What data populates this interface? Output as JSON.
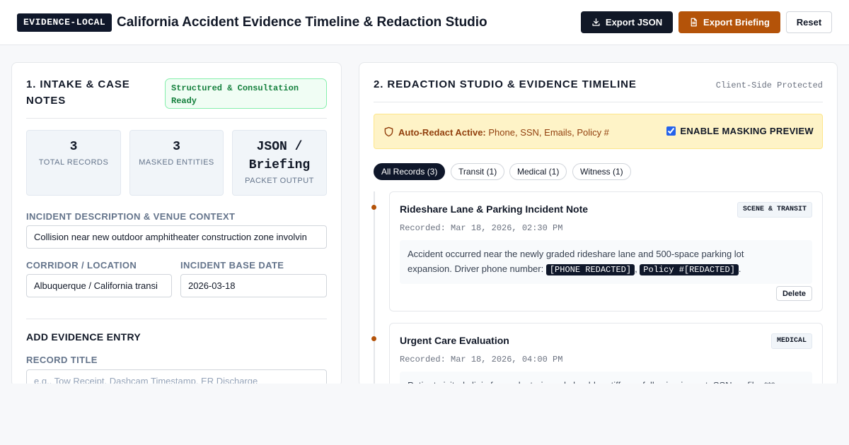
{
  "header": {
    "brand": "EVIDENCE-LOCAL",
    "title": "California Accident Evidence Timeline & Redaction Studio",
    "export_json_label": "Export JSON",
    "export_briefing_label": "Export Briefing",
    "reset_label": "Reset"
  },
  "intake": {
    "title_line1": "1. INTAKE & CASE",
    "title_line2": "NOTES",
    "status_line1": "Structured & Consultation",
    "status_line2": "Ready",
    "stats": [
      {
        "value": "3",
        "label": "TOTAL RECORDS"
      },
      {
        "value": "3",
        "label": "MASKED ENTITIES"
      },
      {
        "value_line1": "JSON /",
        "value_line2": "Briefing",
        "label": "PACKET OUTPUT"
      }
    ],
    "description_label": "INCIDENT DESCRIPTION & VENUE CONTEXT",
    "description_value": "Collision near new outdoor amphitheater construction zone involvin",
    "corridor_label": "CORRIDOR / LOCATION",
    "corridor_value": "Albuquerque / California transi",
    "date_label": "INCIDENT BASE DATE",
    "date_value": "2026-03-18",
    "add_title": "ADD EVIDENCE ENTRY",
    "record_title_label": "RECORD TITLE",
    "record_title_placeholder": "e.g., Tow Receipt, Dashcam Timestamp, ER Discharge"
  },
  "studio": {
    "title": "2. REDACTION STUDIO & EVIDENCE TIMELINE",
    "protected": "Client-Side Protected",
    "banner_bold": "Auto-Redact Active:",
    "banner_text": "Phone, SSN, Emails, Policy #",
    "mask_label": "ENABLE MASKING PREVIEW",
    "filters": [
      "All Records (3)",
      "Transit (1)",
      "Medical (1)",
      "Witness (1)"
    ],
    "entries": [
      {
        "title": "Rideshare Lane & Parking Incident Note",
        "tag": "SCENE & TRANSIT",
        "recorded": "Recorded: Mar 18, 2026, 02:30 PM",
        "body_line1": "Accident occurred near the newly graded rideshare lane and 500-space parking lot",
        "body_line2_pre": "expansion. Driver phone number: ",
        "chip1": "[PHONE REDACTED]",
        "sep": ", ",
        "chip2": "Policy #[REDACTED]",
        "end": ".",
        "delete_label": "Delete"
      },
      {
        "title": "Urgent Care Evaluation",
        "tag": "MEDICAL",
        "recorded": "Recorded: Mar 18, 2026, 04:00 PM",
        "body_line1": "Patient visited clinic for neck strain and shoulder stiffness following impact. SSN on file: ***"
      }
    ]
  },
  "colors": {
    "accent_dark": "#0f172a",
    "accent_amber": "#b45309",
    "success": "#15803d",
    "banner": "#fef3c7"
  }
}
